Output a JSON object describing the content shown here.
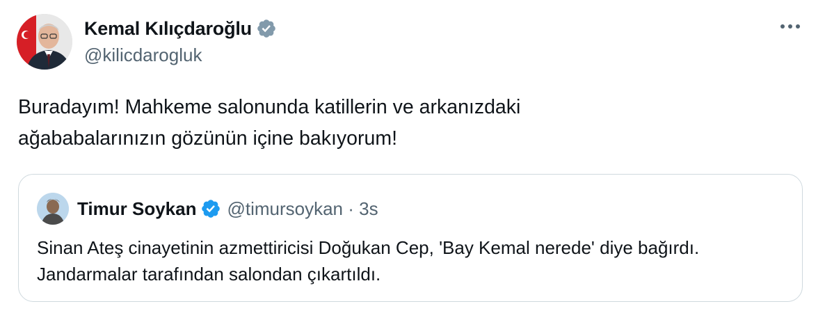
{
  "author": {
    "display_name": "Kemal Kılıçdaroğlu",
    "handle": "@kilicdarogluk",
    "verified_icon": "verified-badge-gray",
    "badge_color": "#829aab"
  },
  "menu": {
    "more_icon": "more-horizontal-icon"
  },
  "tweet": {
    "text": "Buradayım! Mahkeme salonunda katillerin ve arkanızdaki\nağababalarınızın gözünün içine bakıyorum!"
  },
  "quote": {
    "display_name": "Timur Soykan",
    "handle": "@timursoykan",
    "separator": "·",
    "timestamp": "3s",
    "meta": "@timursoykan · 3s",
    "verified_icon": "verified-badge-blue",
    "badge_color": "#1d9bf0",
    "text": "Sinan Ateş cinayetinin azmettiricisi Doğukan Cep, 'Bay Kemal nerede' diye bağırdı. Jandarmalar tarafından salondan çıkartıldı."
  },
  "colors": {
    "text_primary": "#0f1419",
    "text_secondary": "#536471",
    "border": "#cfd9de"
  }
}
